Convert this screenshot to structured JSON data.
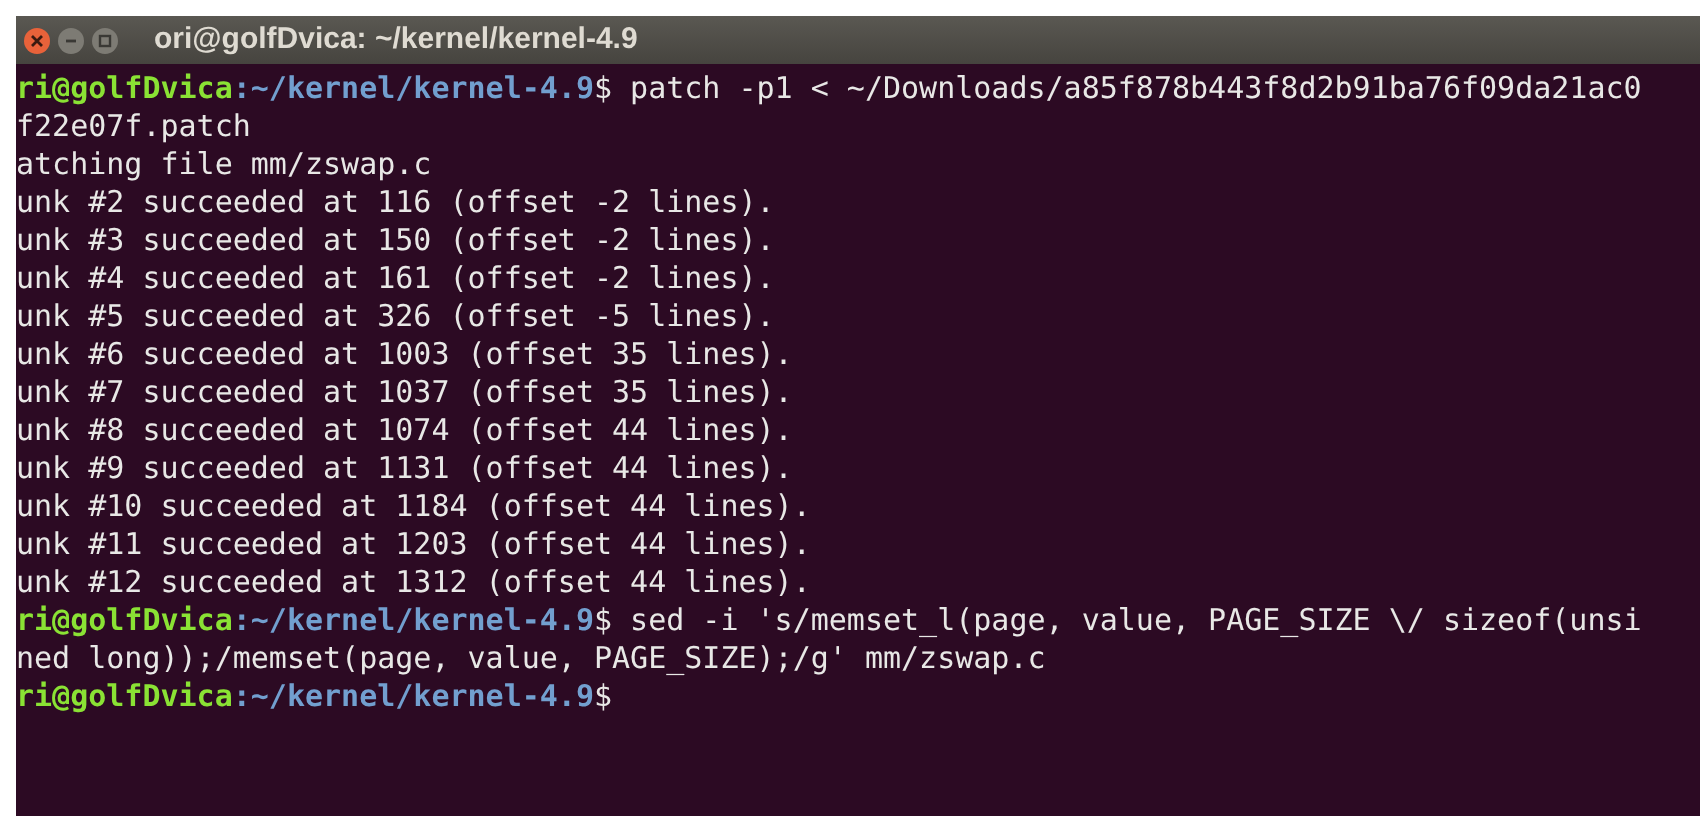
{
  "window": {
    "title": "ori@golfDvica: ~/kernel/kernel-4.9"
  },
  "lines": [
    {
      "kind": "prompt",
      "user": "ri@golfDvica",
      "path": ":~/kernel/kernel-4.9",
      "command": "$ patch -p1 < ~/Downloads/a85f878b443f8d2b91ba76f09da21ac0"
    },
    {
      "kind": "output",
      "text": "f22e07f.patch"
    },
    {
      "kind": "output",
      "text": "atching file mm/zswap.c"
    },
    {
      "kind": "output",
      "text": "unk #2 succeeded at 116 (offset -2 lines)."
    },
    {
      "kind": "output",
      "text": "unk #3 succeeded at 150 (offset -2 lines)."
    },
    {
      "kind": "output",
      "text": "unk #4 succeeded at 161 (offset -2 lines)."
    },
    {
      "kind": "output",
      "text": "unk #5 succeeded at 326 (offset -5 lines)."
    },
    {
      "kind": "output",
      "text": "unk #6 succeeded at 1003 (offset 35 lines)."
    },
    {
      "kind": "output",
      "text": "unk #7 succeeded at 1037 (offset 35 lines)."
    },
    {
      "kind": "output",
      "text": "unk #8 succeeded at 1074 (offset 44 lines)."
    },
    {
      "kind": "output",
      "text": "unk #9 succeeded at 1131 (offset 44 lines)."
    },
    {
      "kind": "output",
      "text": "unk #10 succeeded at 1184 (offset 44 lines)."
    },
    {
      "kind": "output",
      "text": "unk #11 succeeded at 1203 (offset 44 lines)."
    },
    {
      "kind": "output",
      "text": "unk #12 succeeded at 1312 (offset 44 lines)."
    },
    {
      "kind": "prompt",
      "user": "ri@golfDvica",
      "path": ":~/kernel/kernel-4.9",
      "command": "$ sed -i 's/memset_l(page, value, PAGE_SIZE \\/ sizeof(unsi"
    },
    {
      "kind": "output",
      "text": "ned long));/memset(page, value, PAGE_SIZE);/g' mm/zswap.c"
    },
    {
      "kind": "prompt",
      "user": "ri@golfDvica",
      "path": ":~/kernel/kernel-4.9",
      "command": "$"
    }
  ]
}
